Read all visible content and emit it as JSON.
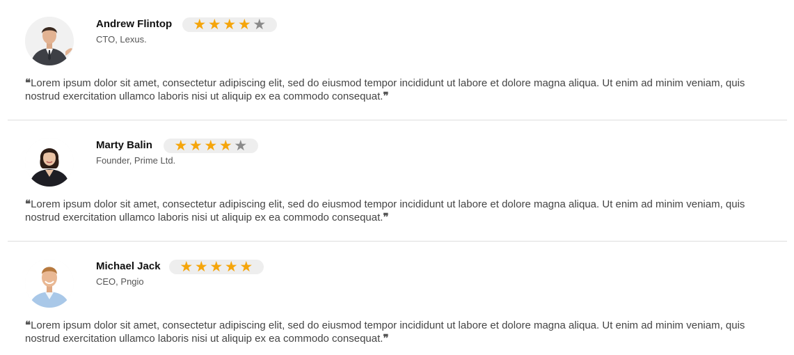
{
  "reviews": [
    {
      "name": "Andrew Flintop",
      "role": "CTO, Lexus.",
      "rating": 4,
      "max_rating": 5,
      "quote": "Lorem ipsum dolor sit amet, consectetur adipiscing elit, sed do eiusmod tempor incididunt ut labore et dolore magna aliqua. Ut enim ad minim veniam, quis nostrud exercitation ullamco laboris nisi ut aliquip ex ea commodo consequat."
    },
    {
      "name": "Marty Balin",
      "role": "Founder, Prime Ltd.",
      "rating": 4,
      "max_rating": 5,
      "quote": "Lorem ipsum dolor sit amet, consectetur adipiscing elit, sed do eiusmod tempor incididunt ut labore et dolore magna aliqua. Ut enim ad minim veniam, quis nostrud exercitation ullamco laboris nisi ut aliquip ex ea commodo consequat."
    },
    {
      "name": "Michael Jack",
      "role": "CEO, Pngio",
      "rating": 5,
      "max_rating": 5,
      "quote": "Lorem ipsum dolor sit amet, consectetur adipiscing elit, sed do eiusmod tempor incididunt ut labore et dolore magna aliqua. Ut enim ad minim veniam, quis nostrud exercitation ullamco laboris nisi ut aliquip ex ea commodo consequat."
    }
  ],
  "icons": {
    "open_quote": "❝",
    "close_quote": "❞",
    "star": "★"
  },
  "colors": {
    "star_on": "#f5a50b",
    "star_off": "#8a8a8a",
    "rating_bg": "#eeeeee",
    "divider": "#dedede"
  }
}
